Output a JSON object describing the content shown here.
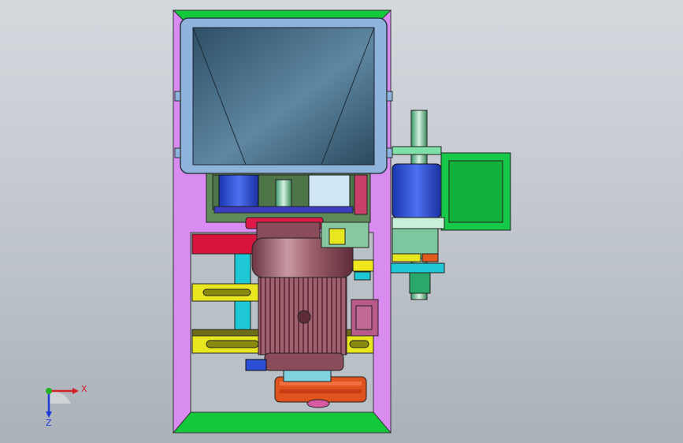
{
  "viewport": {
    "background_top": "#d4d9de",
    "background_bottom": "#aab1b8"
  },
  "colors": {
    "frame_green": "#14c83c",
    "frame_violet": "#d98cf0",
    "hopper_blue": "#8eb4dc",
    "hopper_inner": "#4e7490",
    "motor_body": "#8a4b5a",
    "motor_fins": "#b87b86",
    "red_bar": "#d8143c",
    "yellow_slot": "#e8e61e",
    "cyan_beam": "#1ec8d4",
    "gear_blue": "#2a4ed4",
    "gearbox_green": "#18c848",
    "pulley_orange": "#e0521e",
    "olive": "#6e6e1a"
  },
  "triad": {
    "x_label": "X",
    "z_label": "Z",
    "x_color": "#d2222a",
    "y_color": "#20b020",
    "z_color": "#1f3bd6"
  }
}
